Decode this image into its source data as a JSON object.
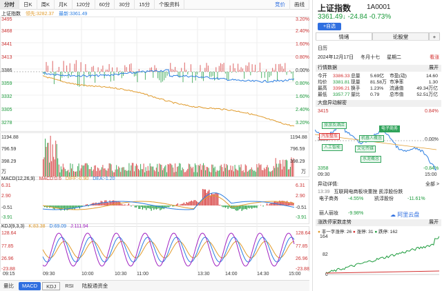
{
  "toolbar": {
    "items": [
      "分时",
      "日K",
      "周K",
      "月K",
      "120分",
      "60分",
      "30分",
      "15分",
      "个股资料"
    ],
    "right": [
      "竞价",
      "画线"
    ]
  },
  "legend": {
    "name": "上证指数",
    "avg": "领先:3282.37",
    "latest": "最新:3361.49"
  },
  "axes": {
    "price_left": [
      "3495",
      "3468",
      "3441",
      "3413",
      "3386",
      "3359",
      "3332",
      "3305",
      "3278"
    ],
    "price_right": [
      "3.20%",
      "2.40%",
      "1.60%",
      "0.80%",
      "0.00%",
      "0.80%",
      "1.60%",
      "2.40%",
      "3.20%"
    ],
    "vol_left": [
      "1194.88",
      "796.59",
      "398.29",
      "万"
    ],
    "vol_right": [
      "1194.88",
      "796.59",
      "398.29",
      "万"
    ],
    "macd_left": [
      "6.31",
      "2.90",
      "-0.51",
      "-3.91"
    ],
    "macd_right": [
      "6.31",
      "2.90",
      "-0.51",
      "-3.91"
    ],
    "kdj_left": [
      "128.64",
      "77.85",
      "26.96",
      "-23.88"
    ],
    "kdj_right": [
      "128.64",
      "77.85",
      "26.96",
      "-23.88"
    ]
  },
  "macd_legend": {
    "name": "MACD(12,26,9)",
    "macd": "MACD:0.6",
    "dif": "DIFF:-0.90",
    "dea": "DEA:-1.20"
  },
  "kdj_legend": {
    "name": "KDJ(9,3,3)",
    "k": "K:83.38",
    "d": "D:69.09",
    "j": "J:111.94"
  },
  "time_axis": [
    "09:15",
    "09:30",
    "10:00",
    "10:30",
    "11:00",
    "13:30",
    "14:00",
    "14:30",
    "15:00"
  ],
  "bottom_tabs": [
    "量比",
    "MACD",
    "KDJ",
    "RSI",
    "陆股通资金"
  ],
  "colors": {
    "up": "#d32f2f",
    "down": "#1a9a3a",
    "accent": "#2f6fe0",
    "price_line": "#2a7de1",
    "avg_line": "#e09a2a"
  },
  "panel": {
    "title": "上证指数",
    "code": "1A0001",
    "price": "3361.49",
    "arrow": "↓",
    "change": "-24.84",
    "pct": "-0.73%",
    "add_btn": "+自选",
    "tabs": [
      "情绪",
      "论股堂",
      "+"
    ],
    "date_label": "日历",
    "date": "2024年12月17日",
    "lunar": "冬月十七",
    "weekday": "星期二",
    "view": "看涨",
    "quote_title": "行情数据",
    "quote_more": "展开",
    "quote": [
      [
        "今开",
        "3386.33",
        "总量",
        "5.69亿",
        "市盈(动)",
        "14.60"
      ],
      [
        "均价",
        "3381.81",
        "现量",
        "81.58万",
        "市净率",
        "1.30"
      ],
      [
        "最高",
        "3396.21",
        "换手",
        "1.23%",
        "流通值",
        "49.34万亿"
      ],
      [
        "最低",
        "3357.77",
        "量比",
        "0.79",
        "总市值",
        "52.51万亿"
      ]
    ],
    "anomaly_title": "大盘异动解密",
    "mini_top_left": "3415",
    "mini_top_right": "0.84%",
    "mini_mid_left": "3386",
    "mini_mid_right": "0.00%",
    "mini_bot_left": "3358",
    "mini_bot_right": "-0.84%",
    "mini_time_start": "09:30",
    "mini_time_end": "15:00",
    "tags": [
      "旅游及酒店",
      "汽车整车",
      "人工智能",
      "机器人概念",
      "文化传媒",
      "电子商务",
      "水泥概念"
    ],
    "detail_title": "异动详情:",
    "detail_more": "全部 >",
    "detail_time": "13:39",
    "detail_text": "互联网电商板块重挫 凯淳股份跌",
    "detail_rows": [
      [
        "电子商务",
        "-4.55%",
        "凯淳股份",
        "-11.61%"
      ],
      [
        "丽人丽妆",
        "-9.98%",
        "",
        ""
      ]
    ],
    "brand": "阿里云盘",
    "limit_title": "涨跌停家数走势",
    "limit_legend": [
      "非一字涨停:",
      "26",
      "涨停:",
      "31",
      "跌停:",
      "162"
    ],
    "limit_axis": [
      "164",
      "82",
      "0"
    ],
    "limit_more": "展开"
  }
}
